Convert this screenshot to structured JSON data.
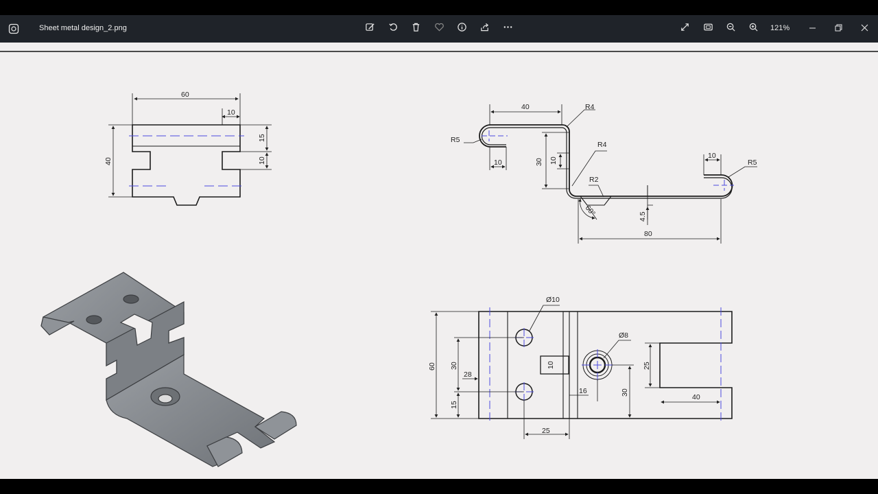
{
  "window": {
    "title": "Sheet metal design_2.png",
    "zoom": "121%"
  },
  "toolbar": {
    "center_icons": [
      "edit-image-icon",
      "rotate-icon",
      "delete-icon",
      "favorite-icon",
      "info-icon",
      "share-icon",
      "more-icon"
    ],
    "right_icons": [
      "fullscreen-icon",
      "fit-icon",
      "zoom-out-icon",
      "zoom-in-icon"
    ]
  },
  "drawing": {
    "front_view": {
      "d60": "60",
      "d10": "10",
      "d15": "15",
      "d10b": "10",
      "d40": "40"
    },
    "side_view": {
      "d40": "40",
      "r4a": "R4",
      "r5a": "R5",
      "d10a": "10",
      "d30": "30",
      "d10b": "10",
      "r4b": "R4",
      "r2": "R2",
      "d10c": "10",
      "r5b": "R5",
      "ang": "60°",
      "d45": "4.5",
      "d80": "80"
    },
    "top_view": {
      "phi10": "Ø10",
      "phi8": "Ø8",
      "d60": "60",
      "d30": "30",
      "d28": "28",
      "d15": "15",
      "d10": "10",
      "d16": "16",
      "d25": "25",
      "d25b": "25",
      "d30b": "30",
      "d40": "40"
    }
  }
}
